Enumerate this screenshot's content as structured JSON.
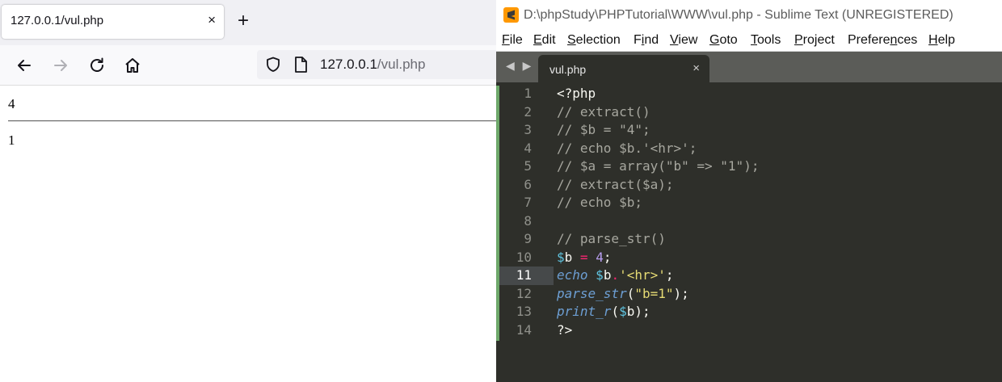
{
  "browser": {
    "tab_title": "127.0.0.1/vul.php",
    "tab_close": "×",
    "new_tab": "+",
    "url_host": "127.0.0.1",
    "url_path": "/vul.php",
    "output_1": "4",
    "output_2": "1"
  },
  "sublime": {
    "window_title": "D:\\phpStudy\\PHPTutorial\\WWW\\vul.php - Sublime Text (UNREGISTERED)",
    "menu": [
      {
        "pre": "",
        "ul": "F",
        "post": "ile"
      },
      {
        "pre": "",
        "ul": "E",
        "post": "dit"
      },
      {
        "pre": "",
        "ul": "S",
        "post": "election"
      },
      {
        "pre": "F",
        "ul": "i",
        "post": "nd"
      },
      {
        "pre": "",
        "ul": "V",
        "post": "iew"
      },
      {
        "pre": "",
        "ul": "G",
        "post": "oto"
      },
      {
        "pre": "",
        "ul": "T",
        "post": "ools"
      },
      {
        "pre": "",
        "ul": "P",
        "post": "roject"
      },
      {
        "pre": "Prefere",
        "ul": "n",
        "post": "ces"
      },
      {
        "pre": "",
        "ul": "H",
        "post": "elp"
      }
    ],
    "tab_arrows": "◀ ▶",
    "tab_title": "vul.php",
    "tab_close": "×",
    "current_line": 11,
    "lines": [
      [
        {
          "t": "<?php",
          "c": "kw"
        }
      ],
      [
        {
          "t": "// extract()",
          "c": "comment"
        }
      ],
      [
        {
          "t": "// $b = \"4\";",
          "c": "comment"
        }
      ],
      [
        {
          "t": "// echo $b.'<hr>';",
          "c": "comment"
        }
      ],
      [
        {
          "t": "// $a = array(\"b\" => \"1\");",
          "c": "comment"
        }
      ],
      [
        {
          "t": "// extract($a);",
          "c": "comment"
        }
      ],
      [
        {
          "t": "// echo $b;",
          "c": "comment"
        }
      ],
      [],
      [
        {
          "t": "// parse_str()",
          "c": "comment"
        }
      ],
      [
        {
          "t": "$",
          "c": "var"
        },
        {
          "t": "b",
          "c": "punc"
        },
        {
          "t": " = ",
          "c": "op"
        },
        {
          "t": "4",
          "c": "num"
        },
        {
          "t": ";",
          "c": "punc"
        }
      ],
      [
        {
          "t": "echo",
          "c": "fn"
        },
        {
          "t": " ",
          "c": "punc"
        },
        {
          "t": "$",
          "c": "var"
        },
        {
          "t": "b",
          "c": "punc"
        },
        {
          "t": ".",
          "c": "op"
        },
        {
          "t": "'<hr>'",
          "c": "str"
        },
        {
          "t": ";",
          "c": "punc"
        }
      ],
      [
        {
          "t": "parse_str",
          "c": "fn"
        },
        {
          "t": "(",
          "c": "punc"
        },
        {
          "t": "\"b=1\"",
          "c": "str"
        },
        {
          "t": ");",
          "c": "punc"
        }
      ],
      [
        {
          "t": "print_r",
          "c": "fn"
        },
        {
          "t": "(",
          "c": "punc"
        },
        {
          "t": "$",
          "c": "var"
        },
        {
          "t": "b",
          "c": "punc"
        },
        {
          "t": ");",
          "c": "punc"
        }
      ],
      [
        {
          "t": "?>",
          "c": "kw"
        }
      ]
    ]
  },
  "colors": {
    "editor_bg": "#2e2f2a",
    "sublime_icon": "#ff9800",
    "modified_gutter": "#6ea86a"
  }
}
